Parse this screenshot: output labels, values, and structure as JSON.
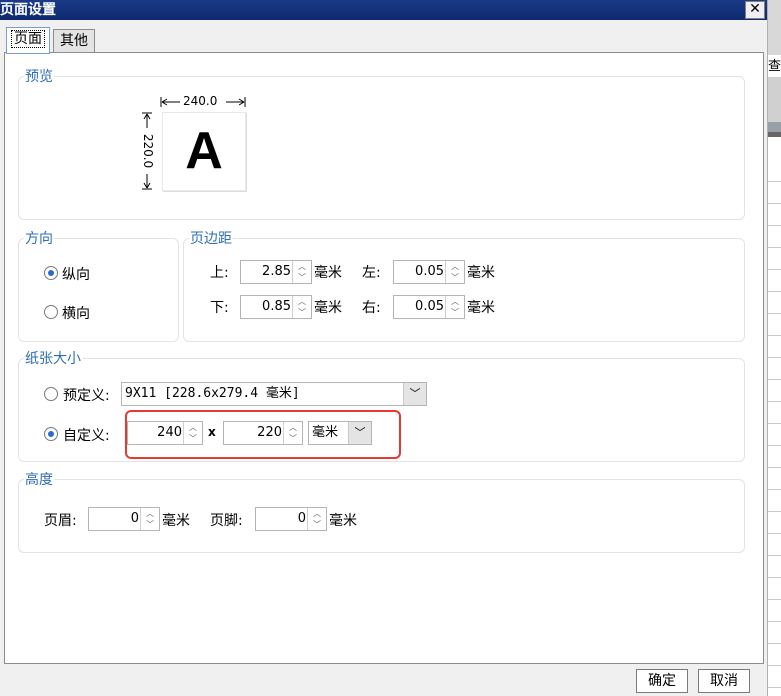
{
  "window": {
    "title": "页面设置",
    "close_icon": "✕"
  },
  "tabs": [
    {
      "label": "页面",
      "active": true
    },
    {
      "label": "其他",
      "active": false
    }
  ],
  "right_strip": {
    "text": "查"
  },
  "preview": {
    "label": "预览",
    "width_label": "240.0",
    "height_label": "220.0",
    "letter": "A"
  },
  "orientation": {
    "label": "方向",
    "portrait": "纵向",
    "landscape": "横向",
    "selected": "portrait"
  },
  "margins": {
    "label": "页边距",
    "top_label": "上:",
    "top": "2.85",
    "bottom_label": "下:",
    "bottom": "0.85",
    "left_label": "左:",
    "left": "0.05",
    "right_label": "右:",
    "right": "0.05",
    "unit": "毫米"
  },
  "paper": {
    "label": "纸张大小",
    "predefined_label": "预定义:",
    "predefined_value": "9X11 [228.6x279.4 毫米]",
    "custom_label": "自定义:",
    "custom_width": "240",
    "times": "x",
    "custom_height": "220",
    "unit": "毫米",
    "selected": "custom"
  },
  "height": {
    "label": "高度",
    "header_label": "页眉:",
    "header": "0",
    "footer_label": "页脚:",
    "footer": "0",
    "unit": "毫米"
  },
  "buttons": {
    "ok": "确定",
    "cancel": "取消"
  },
  "colors": {
    "title_bar": "#0e2a6e",
    "group_label": "#2e6db4",
    "highlight": "#e53935",
    "radio_dot": "#2a6bd0"
  }
}
